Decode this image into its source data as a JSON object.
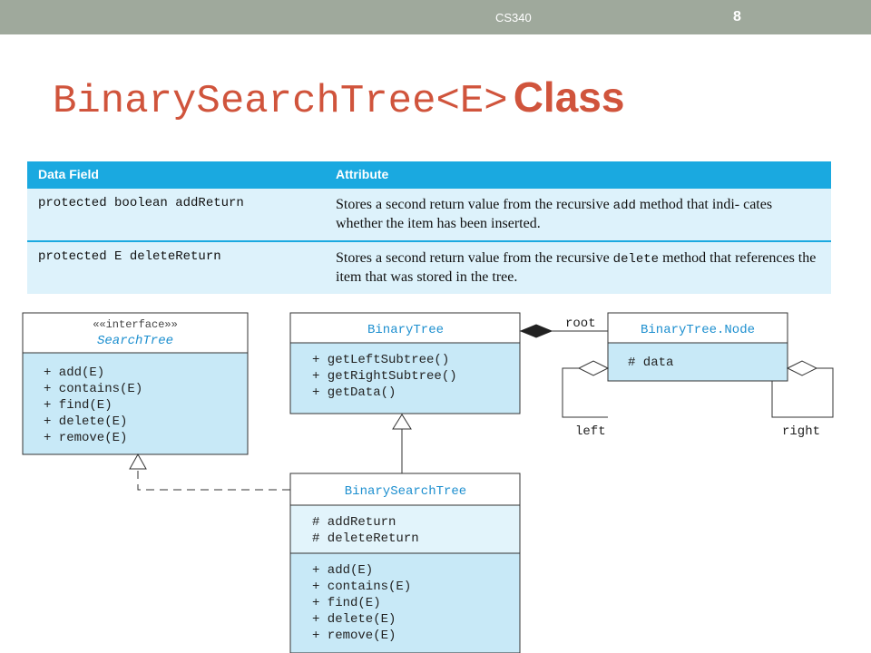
{
  "header": {
    "course": "CS340",
    "page_number": "8"
  },
  "title": {
    "code": "BinarySearchTree<E>",
    "word": "Class"
  },
  "table": {
    "headers": [
      "Data Field",
      "Attribute"
    ],
    "rows": [
      {
        "field": "protected boolean addReturn",
        "attr_pre": "Stores a second return value from the recursive ",
        "attr_code": "add",
        "attr_post": " method that indi- cates whether the item has been inserted."
      },
      {
        "field": "protected E deleteReturn",
        "attr_pre": "Stores a second return value from the recursive ",
        "attr_code": "delete",
        "attr_post": " method that references the item that was stored in the tree."
      }
    ]
  },
  "diagram": {
    "search_tree": {
      "stereotype": "««interface»»",
      "name": "SearchTree",
      "methods": [
        "+ add(E)",
        "+ contains(E)",
        "+ find(E)",
        "+ delete(E)",
        "+ remove(E)"
      ]
    },
    "binary_tree": {
      "name": "BinaryTree",
      "methods": [
        "+ getLeftSubtree()",
        "+ getRightSubtree()",
        "+ getData()"
      ]
    },
    "node": {
      "name": "BinaryTree.Node",
      "fields": [
        "# data"
      ]
    },
    "bst": {
      "name": "BinarySearchTree",
      "fields": [
        "# addReturn",
        "# deleteReturn"
      ],
      "methods": [
        "+ add(E)",
        "+ contains(E)",
        "+ find(E)",
        "+ delete(E)",
        "+ remove(E)"
      ]
    },
    "labels": {
      "root": "root",
      "left": "left",
      "right": "right"
    }
  },
  "colors": {
    "topbar": "#9fa99c",
    "title": "#d0543c",
    "table_header": "#1aa9e0",
    "table_body": "#ddf2fb",
    "uml_header_text": "#1d8fcf",
    "uml_fill": "#c8e9f7",
    "uml_fill_light": "#e2f4fb"
  }
}
